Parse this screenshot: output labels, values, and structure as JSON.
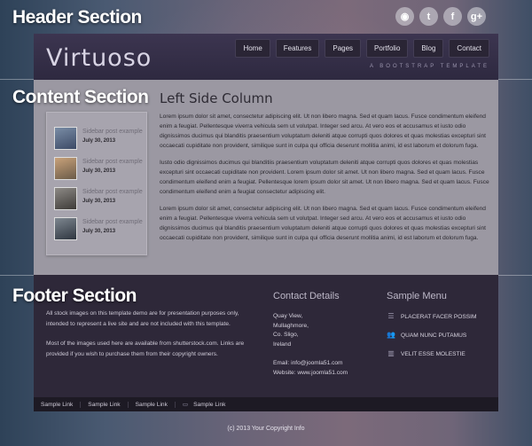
{
  "labels": {
    "header": "Header Section",
    "content": "Content Section",
    "footer": "Footer Section"
  },
  "social": [
    {
      "icon": "rss-icon",
      "glyph": "◉"
    },
    {
      "icon": "twitter-icon",
      "glyph": "t"
    },
    {
      "icon": "facebook-icon",
      "glyph": "f"
    },
    {
      "icon": "googleplus-icon",
      "glyph": "g+"
    }
  ],
  "header": {
    "logo": "Virtuoso",
    "tagline": "A BOOTSTRAP TEMPLATE",
    "nav": [
      "Home",
      "Features",
      "Pages",
      "Portfolio",
      "Blog",
      "Contact"
    ]
  },
  "sidebar": {
    "posts": [
      {
        "title": "Sidebar post example",
        "date": "July 30, 2013"
      },
      {
        "title": "Sidebar post example",
        "date": "July 30, 2013"
      },
      {
        "title": "Sidebar post example",
        "date": "July 30, 2013"
      },
      {
        "title": "Sidebar post example",
        "date": "July 30, 2013"
      }
    ]
  },
  "main": {
    "heading": "Left Side Column",
    "paragraphs": [
      "Lorem ipsum dolor sit amet, consectetur adipiscing elit. Ut non libero magna. Sed et quam lacus. Fusce condimentum eleifend enim a feugiat. Pellentesque viverra vehicula sem ut volutpat. Integer sed arcu. At vero eos et accusamus et iusto odio dignissimos ducimus qui blanditis praesentium voluptatum deleniti atque corrupti quos dolores et quas molestias excepturi sint occaecati cupiditate non provident, similique sunt in culpa qui officia deserunt mollitia animi, id est laborum et dolorum fuga.",
      "Iusto odio dignissimos ducimus qui blanditiis praesentium voluptatum deleniti atque corrupti quos dolores et quas molestias excepturi sint occaecati cupiditate non provident. Lorem ipsum dolor sit amet. Ut non libero magna. Sed et quam lacus. Fusce condimentum eleifend enim a feugiat. Pellentesque lorem ipsum dolor sit amet. Ut non libero magna. Sed et quam lacus. Fusce condimentum eleifend enim a feugiat consectetur adipiscing elit.",
      "Lorem ipsum dolor sit amet, consectetur adipiscing elit. Ut non libero magna. Sed et quam lacus. Fusce condimentum eleifend enim a feugiat. Pellentesque viverra vehicula sem ut volutpat. Integer sed arcu. At vero eos et accusamus et iusto odio dignissimos ducimus qui blanditis praesentium voluptatum deleniti atque corrupti quos dolores et quas molestias excepturi sint occaecati cupiditate non provident, similique sunt in culpa qui officia deserunt mollitia animi, id est laborum et dolorum fuga."
    ]
  },
  "footer": {
    "about": [
      "All stock images on this template demo are for presentation purposes only, intended to represent a live site and are not included with this template.",
      "Most of the images used here are available from shutterstock.com. Links are provided if you wish to purchase them from their copyright owners."
    ],
    "contact": {
      "title": "Contact Details",
      "address": [
        "Quay View,",
        "Mullaghmore,",
        "Co. Sligo,",
        "Ireland"
      ],
      "email": "Email: info@joomla51.com",
      "website": "Website: www.joomla51.com"
    },
    "menu": {
      "title": "Sample Menu",
      "items": [
        {
          "label": "PLACERAT FACER POSSIM",
          "icon": "list-icon",
          "glyph": "☰"
        },
        {
          "label": "QUAM NUNC PUTAMUS",
          "icon": "users-icon",
          "glyph": "👥"
        },
        {
          "label": "VELIT ESSE MOLESTIE",
          "icon": "bar-chart-icon",
          "glyph": "▥"
        }
      ]
    },
    "links": [
      "Sample Link",
      "Sample Link",
      "Sample Link",
      "Sample Link"
    ],
    "copyright": "(c) 2013 Your Copyright Info"
  }
}
